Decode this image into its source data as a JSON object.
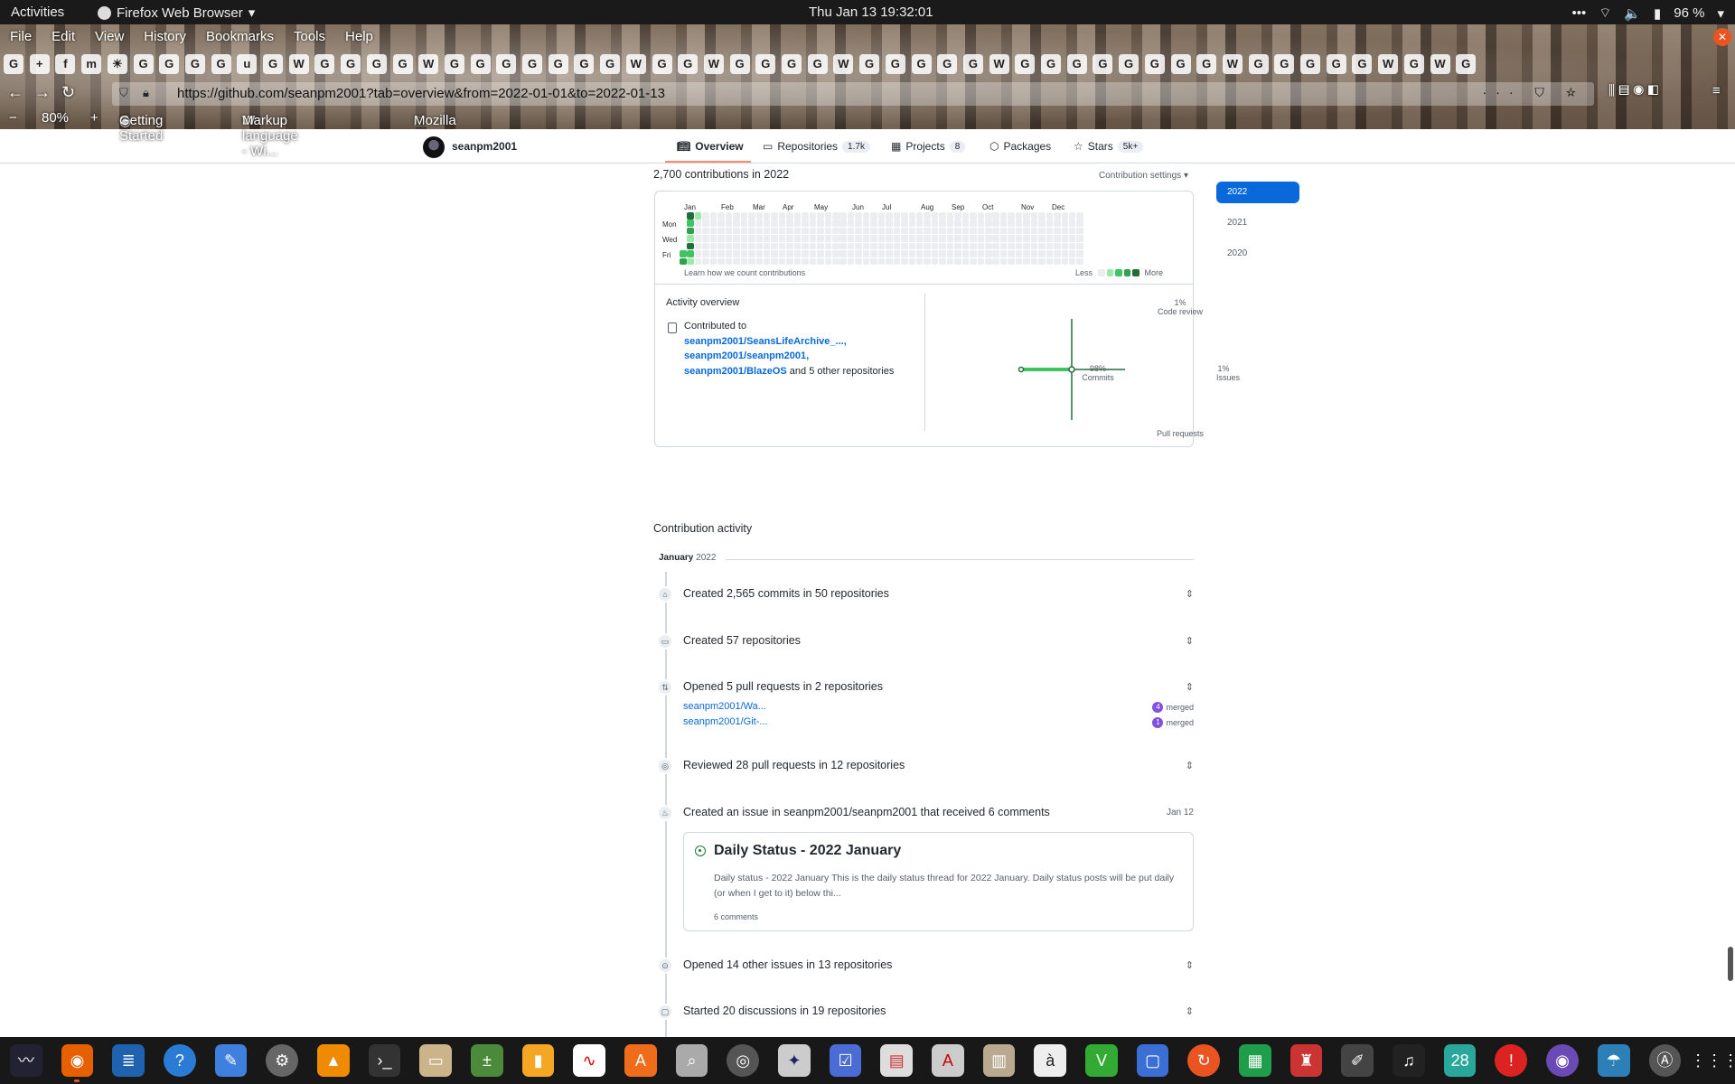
{
  "topbar": {
    "activities": "Activities",
    "app": "Firefox Web Browser",
    "clock": "Thu Jan 13  19:32:01",
    "battery": "96 %"
  },
  "browser": {
    "menu": [
      "File",
      "Edit",
      "View",
      "History",
      "Bookmarks",
      "Tools",
      "Help"
    ],
    "url": "https://github.com/seanpm2001?tab=overview&from=2022-01-01&to=2022-01-13",
    "zoom": "80%",
    "bookmarks": [
      "Getting Started",
      "Markup language - Wi...",
      "Mozilla"
    ],
    "tab_icons": [
      "G",
      "+",
      "f",
      "m",
      "☀",
      "G",
      "G",
      "G",
      "G",
      "u",
      "G",
      "W",
      "G",
      "G",
      "G",
      "G",
      "W",
      "G",
      "G",
      "G",
      "G",
      "G",
      "G",
      "G",
      "W",
      "G",
      "G",
      "W",
      "G",
      "G",
      "G",
      "G",
      "W",
      "G",
      "G",
      "G",
      "G",
      "G",
      "W",
      "G",
      "G",
      "G",
      "G",
      "G",
      "G",
      "G",
      "G",
      "W",
      "G",
      "G",
      "G",
      "G",
      "G",
      "W",
      "G",
      "W",
      "G"
    ]
  },
  "profile": {
    "username": "seanpm2001",
    "tabs": [
      {
        "label": "Overview",
        "count": ""
      },
      {
        "label": "Repositories",
        "count": "1.7k"
      },
      {
        "label": "Projects",
        "count": "8"
      },
      {
        "label": "Packages",
        "count": ""
      },
      {
        "label": "Stars",
        "count": "5k+"
      }
    ]
  },
  "contributions": {
    "heading": "2,700 contributions in 2022",
    "settings": "Contribution settings ▾",
    "years": [
      "2022",
      "2021",
      "2020"
    ],
    "months": [
      "Jan",
      "Feb",
      "Mar",
      "Apr",
      "May",
      "Jun",
      "Jul",
      "Aug",
      "Sep",
      "Oct",
      "Nov",
      "Dec"
    ],
    "days": [
      "Mon",
      "Wed",
      "Fri"
    ],
    "learn": "Learn how we count contributions",
    "less": "Less",
    "more": "More",
    "level_colors": [
      "#ebedf0",
      "#9be9a8",
      "#40c463",
      "#30a14e",
      "#216e39"
    ]
  },
  "activity_overview": {
    "title": "Activity overview",
    "contributed_to": "Contributed to",
    "repos": [
      "seanpm2001/SeansLifeArchive_...,",
      "seanpm2001/seanpm2001,",
      "seanpm2001/BlazeOS"
    ],
    "and_others": " and 5 other repositories",
    "axes": {
      "code_review_pct": "1%",
      "code_review": "Code review",
      "commits_pct": "98%",
      "commits": "Commits",
      "issues_pct": "1%",
      "issues": "Issues",
      "pull_requests": "Pull requests"
    }
  },
  "activity": {
    "heading": "Contribution activity",
    "month": "January",
    "year": "2022",
    "events": [
      {
        "text": "Created 2,565 commits in 50 repositories",
        "icon": "commit-icon"
      },
      {
        "text": "Created 57 repositories",
        "icon": "repo-icon"
      },
      {
        "text": "Opened 5 pull requests in 2 repositories",
        "icon": "pull-request-icon"
      },
      {
        "text": "Reviewed 28 pull requests in 12 repositories",
        "icon": "eye-icon"
      },
      {
        "text": "Created an issue in seanpm2001/seanpm2001 that received 6 comments",
        "icon": "flame-icon",
        "date": "Jan 12"
      },
      {
        "text": "Opened 14 other issues in 13 repositories",
        "icon": "issue-icon"
      },
      {
        "text": "Started 20 discussions in 19 repositories",
        "icon": "discussion-icon"
      }
    ],
    "pull_requests": [
      {
        "repo": "seanpm2001/Wa...",
        "count": "4",
        "status": "merged"
      },
      {
        "repo": "seanpm2001/Git-...",
        "count": "1",
        "status": "merged"
      }
    ],
    "issue": {
      "title": "Daily Status - 2022 January",
      "body": "Daily status - 2022 January This is the daily status thread for 2022 January. Daily status posts will be put daily (or when I get to it) below thi...",
      "comments": "6 comments"
    }
  },
  "dock": {
    "calendar_day": "28"
  }
}
